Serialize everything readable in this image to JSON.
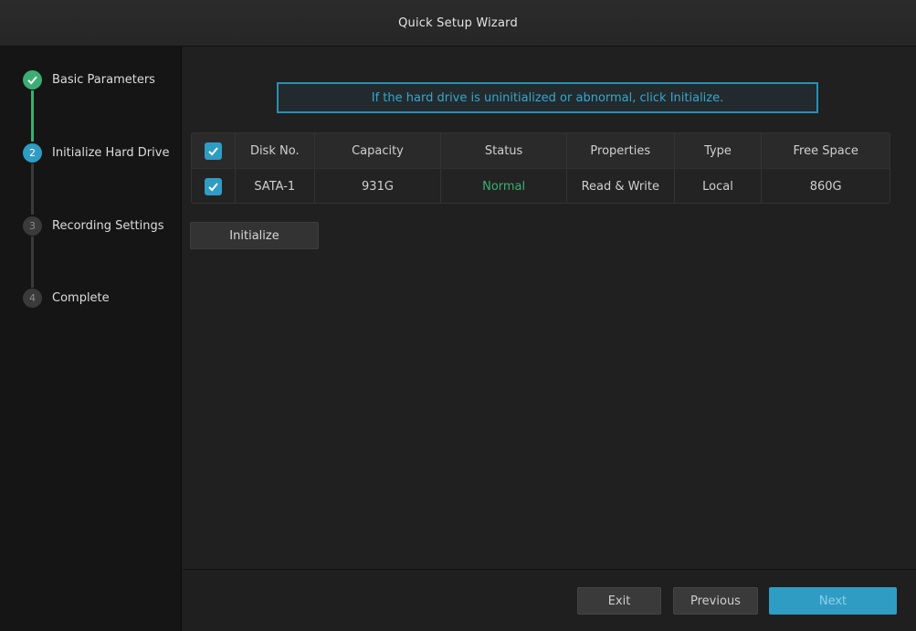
{
  "window": {
    "title": "Quick Setup Wizard"
  },
  "steps": [
    {
      "number": "1",
      "label": "Basic Parameters",
      "state": "done"
    },
    {
      "number": "2",
      "label": "Initialize Hard Drive",
      "state": "active"
    },
    {
      "number": "3",
      "label": "Recording Settings",
      "state": "pending"
    },
    {
      "number": "4",
      "label": "Complete",
      "state": "pending"
    }
  ],
  "main": {
    "info_text": "If the hard drive is uninitialized or abnormal, click Initialize.",
    "table": {
      "headers": [
        "Disk No.",
        "Capacity",
        "Status",
        "Properties",
        "Type",
        "Free Space"
      ],
      "header_checked": true,
      "rows": [
        {
          "checked": true,
          "disk_no": "SATA-1",
          "capacity": "931G",
          "status": "Normal",
          "properties": "Read & Write",
          "type": "Local",
          "free_space": "860G"
        }
      ]
    },
    "initialize_label": "Initialize"
  },
  "footer": {
    "exit_label": "Exit",
    "previous_label": "Previous",
    "next_label": "Next"
  },
  "colors": {
    "accent": "#2f9cc4",
    "success": "#3dae73"
  },
  "icons": {
    "step_done": "checkmark-icon",
    "checkbox": "checkbox-checked-icon"
  }
}
